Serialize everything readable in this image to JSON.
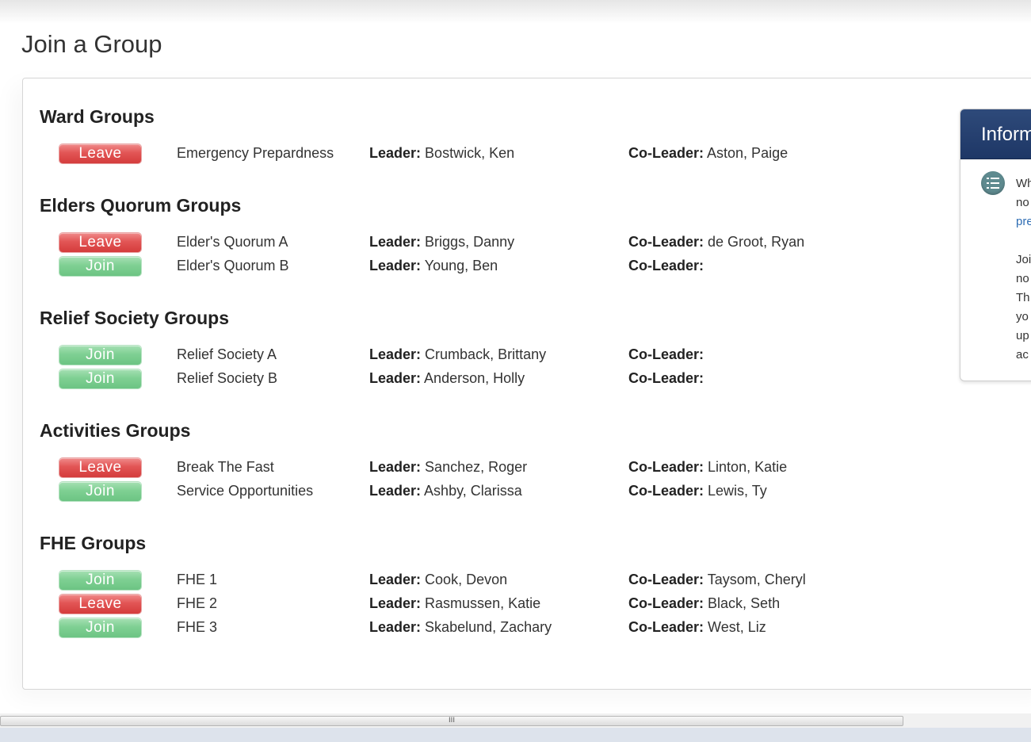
{
  "page": {
    "title": "Join a Group"
  },
  "labels": {
    "leader": "Leader:",
    "coleader": "Co-Leader:"
  },
  "sections": [
    {
      "title": "Ward Groups",
      "groups": [
        {
          "action": "Leave",
          "name": "Emergency Prepardness",
          "leader": "Bostwick, Ken",
          "coleader": "Aston, Paige"
        }
      ]
    },
    {
      "title": "Elders Quorum Groups",
      "groups": [
        {
          "action": "Leave",
          "name": "Elder's Quorum A",
          "leader": "Briggs, Danny",
          "coleader": "de Groot, Ryan"
        },
        {
          "action": "Join",
          "name": "Elder's Quorum B",
          "leader": "Young, Ben",
          "coleader": ""
        }
      ]
    },
    {
      "title": "Relief Society Groups",
      "groups": [
        {
          "action": "Join",
          "name": "Relief Society A",
          "leader": "Crumback, Brittany",
          "coleader": ""
        },
        {
          "action": "Join",
          "name": "Relief Society B",
          "leader": "Anderson, Holly",
          "coleader": ""
        }
      ]
    },
    {
      "title": "Activities Groups",
      "groups": [
        {
          "action": "Leave",
          "name": "Break The Fast",
          "leader": "Sanchez, Roger",
          "coleader": "Linton, Katie"
        },
        {
          "action": "Join",
          "name": "Service Opportunities",
          "leader": "Ashby, Clarissa",
          "coleader": "Lewis, Ty"
        }
      ]
    },
    {
      "title": "FHE Groups",
      "groups": [
        {
          "action": "Join",
          "name": "FHE 1",
          "leader": "Cook, Devon",
          "coleader": "Taysom, Cheryl"
        },
        {
          "action": "Leave",
          "name": "FHE 2",
          "leader": "Rasmussen, Katie",
          "coleader": "Black, Seth"
        },
        {
          "action": "Join",
          "name": "FHE 3",
          "leader": "Skabelund, Zachary",
          "coleader": "West, Liz"
        }
      ]
    }
  ],
  "info_card": {
    "title": "Inform",
    "lines": [
      "Wh",
      "no",
      "pre",
      "",
      "Joi",
      "no",
      "Th",
      "yo",
      "up",
      "ac"
    ],
    "link_line_index": 2
  },
  "scrollbar": {
    "grip": "III"
  },
  "colors": {
    "leave": "#d94848",
    "join": "#7fd093",
    "header": "#23406f"
  },
  "icons": {
    "info": "list-icon"
  }
}
